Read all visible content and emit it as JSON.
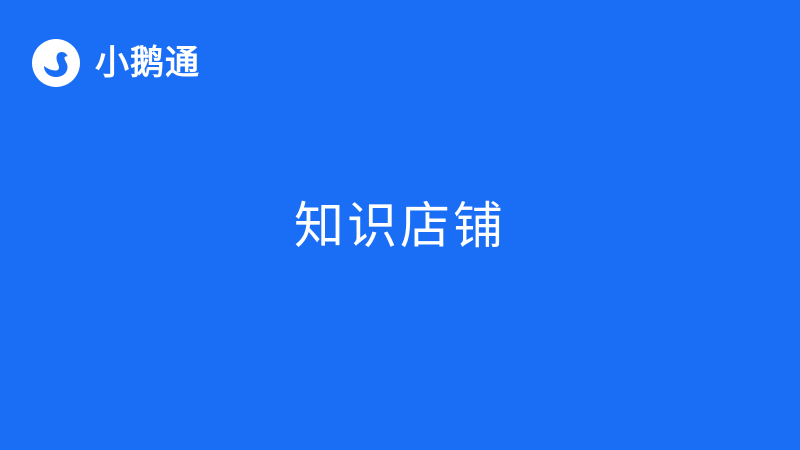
{
  "brand": {
    "name": "小鹅通",
    "logo_icon": "goose-logo-icon"
  },
  "main": {
    "title": "知识店铺"
  },
  "colors": {
    "background": "#1a6ef5",
    "foreground": "#ffffff"
  }
}
